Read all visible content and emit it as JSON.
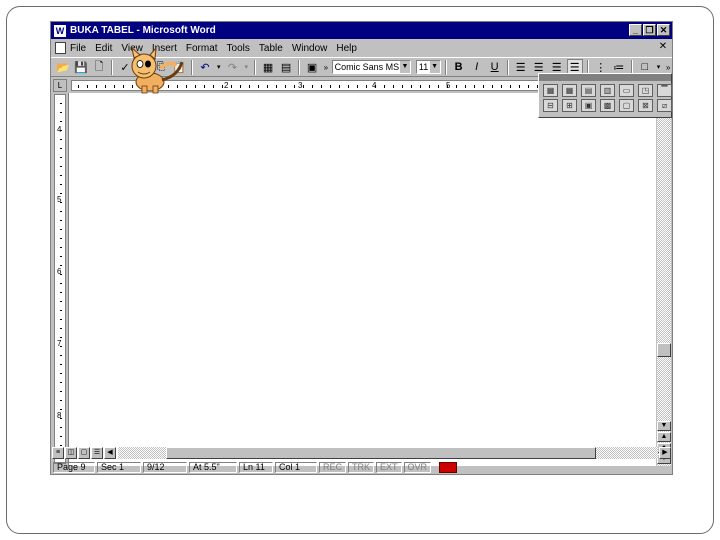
{
  "window": {
    "title": "BUKA TABEL - Microsoft Word",
    "minimize": "_",
    "restore": "❐",
    "close": "✕"
  },
  "menubar": {
    "items": [
      "File",
      "Edit",
      "View",
      "Insert",
      "Format",
      "Tools",
      "Table",
      "Window",
      "Help"
    ],
    "close_doc": "✕"
  },
  "toolbar": {
    "font_name": "Comic Sans MS",
    "font_size": "11",
    "bold": "B",
    "italic": "I",
    "underline": "U"
  },
  "ruler": {
    "numbers": [
      "1",
      "2",
      "3",
      "4",
      "5"
    ]
  },
  "vruler": {
    "numbers": [
      "4",
      "5",
      "6",
      "7",
      "8"
    ]
  },
  "status": {
    "page": "Page 9",
    "sec": "Sec 1",
    "pages": "9/12",
    "at": "At 5.5\"",
    "ln": "Ln 11",
    "col": "Col 1",
    "rec": "REC",
    "trk": "TRK",
    "ext": "EXT",
    "ovr": "OVR"
  },
  "colors": {
    "titlebar": "#000080",
    "chrome": "#c0c0c0"
  }
}
